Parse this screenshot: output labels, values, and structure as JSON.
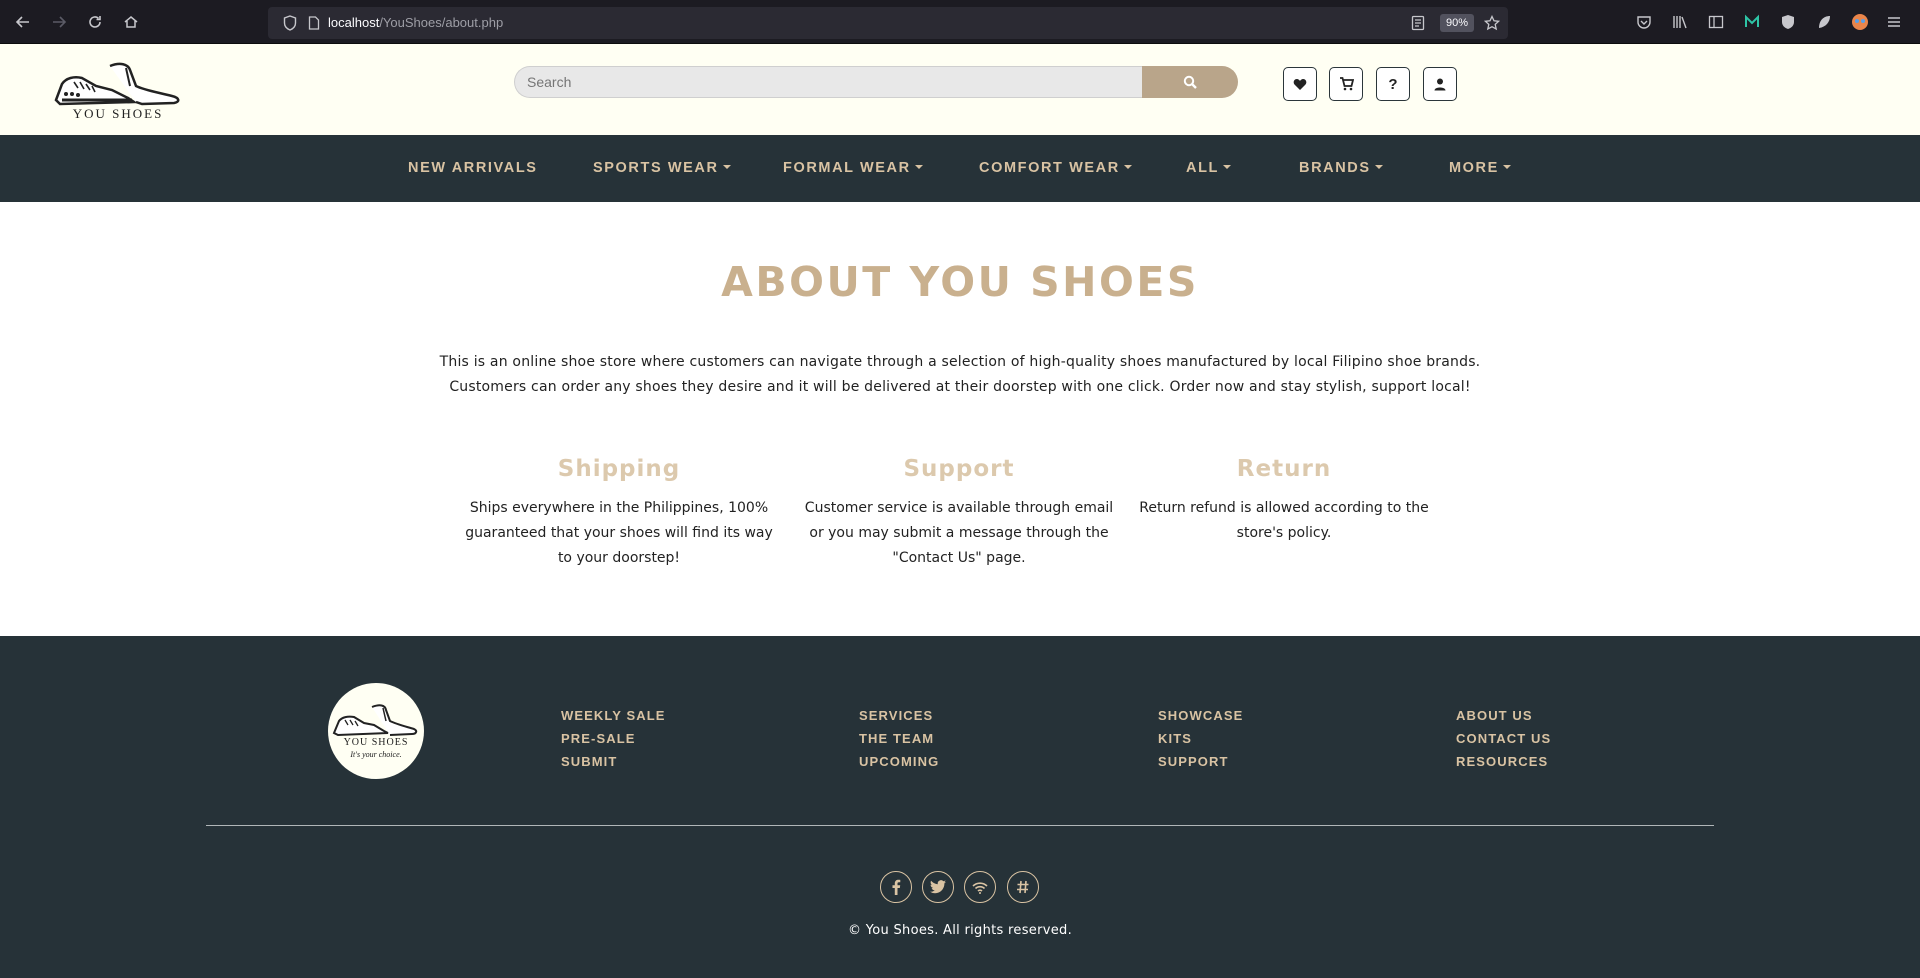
{
  "browser": {
    "url_host": "localhost",
    "url_path": "/YouShoes/about.php",
    "zoom": "90%"
  },
  "header": {
    "logo_text": "YOU SHOES",
    "search_placeholder": "Search",
    "icons": [
      "heart-icon",
      "cart-icon",
      "help-icon",
      "user-icon"
    ],
    "help_label": "?"
  },
  "nav": {
    "items": [
      {
        "label": "NEW ARRIVALS",
        "dropdown": false
      },
      {
        "label": "SPORTS WEAR",
        "dropdown": true
      },
      {
        "label": "FORMAL WEAR",
        "dropdown": true
      },
      {
        "label": "COMFORT WEAR",
        "dropdown": true
      },
      {
        "label": "ALL",
        "dropdown": true
      },
      {
        "label": "BRANDS",
        "dropdown": true
      },
      {
        "label": "MORE",
        "dropdown": true
      }
    ]
  },
  "about": {
    "title": "ABOUT YOU SHOES",
    "desc_line1": "This is an online shoe store where customers can navigate through a selection of high-quality shoes manufactured by local Filipino shoe brands.",
    "desc_line2": "Customers can order any shoes they desire and it will be delivered at their doorstep with one click. Order now and stay stylish, support local!",
    "features": [
      {
        "title": "Shipping",
        "text": "Ships everywhere in the Philippines, 100% guaranteed that your shoes will find its way to your doorstep!"
      },
      {
        "title": "Support",
        "text": "Customer service is available through email or you may submit a message through the \"Contact Us\" page."
      },
      {
        "title": "Return",
        "text": "Return refund is allowed according to the store's policy."
      }
    ]
  },
  "footer": {
    "logo_text": "YOU SHOES",
    "logo_tagline": "It's your choice.",
    "columns": [
      [
        "WEEKLY SALE",
        "PRE-SALE",
        "SUBMIT"
      ],
      [
        "SERVICES",
        "THE TEAM",
        "UPCOMING"
      ],
      [
        "SHOWCASE",
        "KITS",
        "SUPPORT"
      ],
      [
        "ABOUT US",
        "CONTACT US",
        "RESOURCES"
      ]
    ],
    "social": [
      "facebook-icon",
      "twitter-icon",
      "wifi-icon",
      "hashtag-icon"
    ],
    "copyright": "© You Shoes. All rights reserved."
  },
  "colors": {
    "header_bg": "#fffff3",
    "nav_bg": "#263238",
    "accent": "#d9c3a3",
    "title": "#c9b08e"
  }
}
